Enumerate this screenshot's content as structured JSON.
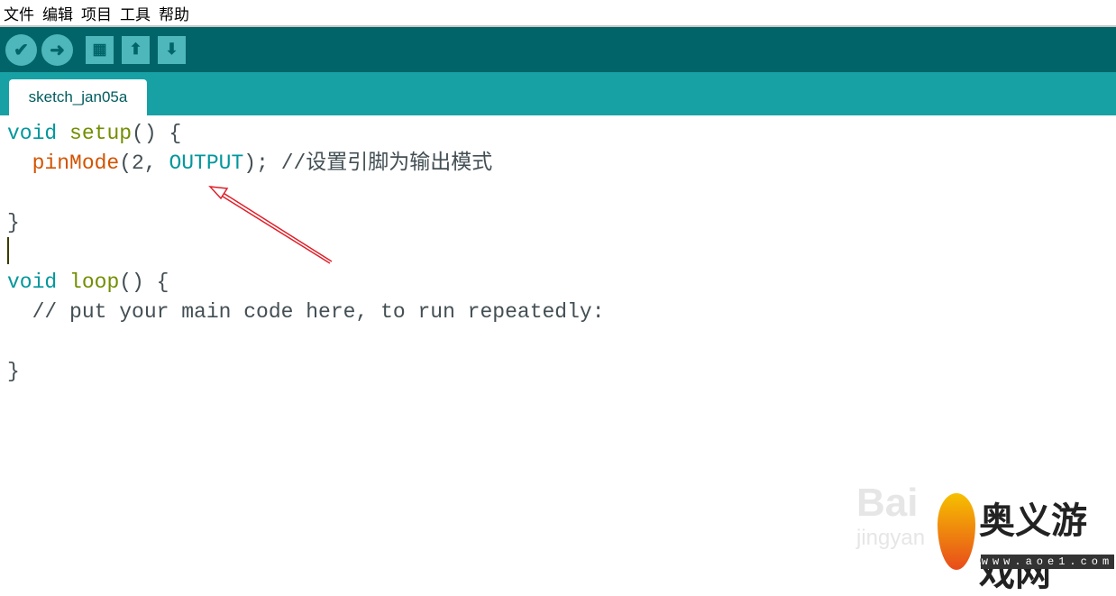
{
  "menu": [
    "文件",
    "编辑",
    "项目",
    "工具",
    "帮助"
  ],
  "toolbar": {
    "verify_icon": "checkmark-icon",
    "upload_icon": "arrow-right-icon",
    "new_icon": "document-icon",
    "open_icon": "arrow-up-icon",
    "save_icon": "arrow-down-icon"
  },
  "tab": {
    "label": "sketch_jan05a"
  },
  "code": {
    "l1": {
      "kw": "void",
      "fn": "setup",
      "rest": "() {"
    },
    "l2": {
      "indent": "  ",
      "fn": "pinMode",
      "a": "(2, ",
      "kw": "OUTPUT",
      "b": "); ",
      "cm": "//设置引脚为输出模式"
    },
    "l4": "}",
    "l6": {
      "kw": "void",
      "fn": "loop",
      "rest": "() {"
    },
    "l7": "  // put your main code here, to run repeatedly:",
    "l9": "}"
  },
  "watermark": {
    "baidu": "Baidu jingyan",
    "site": "奥义游戏网",
    "url": "www.aoe1.com"
  },
  "colors": {
    "toolbar": "#006468",
    "tabbar": "#17a1a5",
    "keyword": "#00979c",
    "function": "#d35400",
    "annotation": "#e0202a"
  }
}
